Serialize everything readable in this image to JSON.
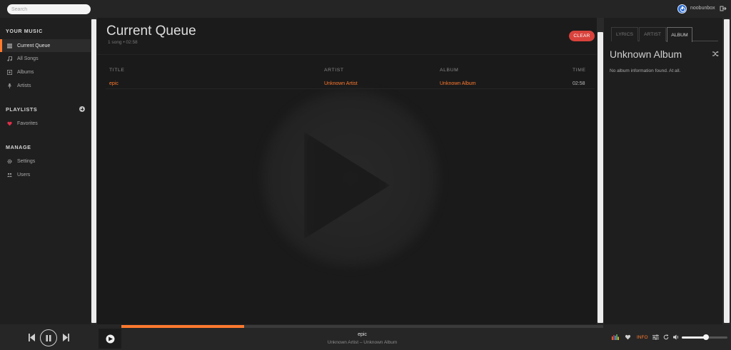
{
  "topbar": {
    "search_placeholder": "Search",
    "username": "noobunbox"
  },
  "sidebar": {
    "your_music_title": "YOUR MUSIC",
    "music_items": [
      {
        "label": "Current Queue",
        "icon": "queue-icon"
      },
      {
        "label": "All Songs",
        "icon": "music-note-icon"
      },
      {
        "label": "Albums",
        "icon": "album-icon"
      },
      {
        "label": "Artists",
        "icon": "microphone-icon"
      }
    ],
    "playlists_title": "PLAYLISTS",
    "playlist_items": [
      {
        "label": "Favorites",
        "icon": "heart-icon"
      }
    ],
    "manage_title": "MANAGE",
    "manage_items": [
      {
        "label": "Settings",
        "icon": "gear-icon"
      },
      {
        "label": "Users",
        "icon": "users-icon"
      }
    ]
  },
  "main": {
    "title": "Current Queue",
    "meta": "1 song • 02:58",
    "clear_label": "CLEAR",
    "columns": [
      "TITLE",
      "ARTIST",
      "ALBUM",
      "TIME"
    ],
    "rows": [
      {
        "title": "epic",
        "artist": "Unknown Artist",
        "album": "Unknown Album",
        "time": "02:58"
      }
    ]
  },
  "right_panel": {
    "tabs": [
      "LYRICS",
      "ARTIST",
      "ALBUM"
    ],
    "active_tab": "ALBUM",
    "album_title": "Unknown Album",
    "album_info": "No album information found. At all."
  },
  "player": {
    "song_title": "epic",
    "song_subtitle": "Unknown Artist – Unknown Album",
    "progress_fraction": 0.255,
    "volume_fraction": 0.53,
    "info_label": "INFO"
  },
  "colors": {
    "accent": "#ff7a2f",
    "clear_button": "#d9423c",
    "heart": "#e0304a"
  }
}
